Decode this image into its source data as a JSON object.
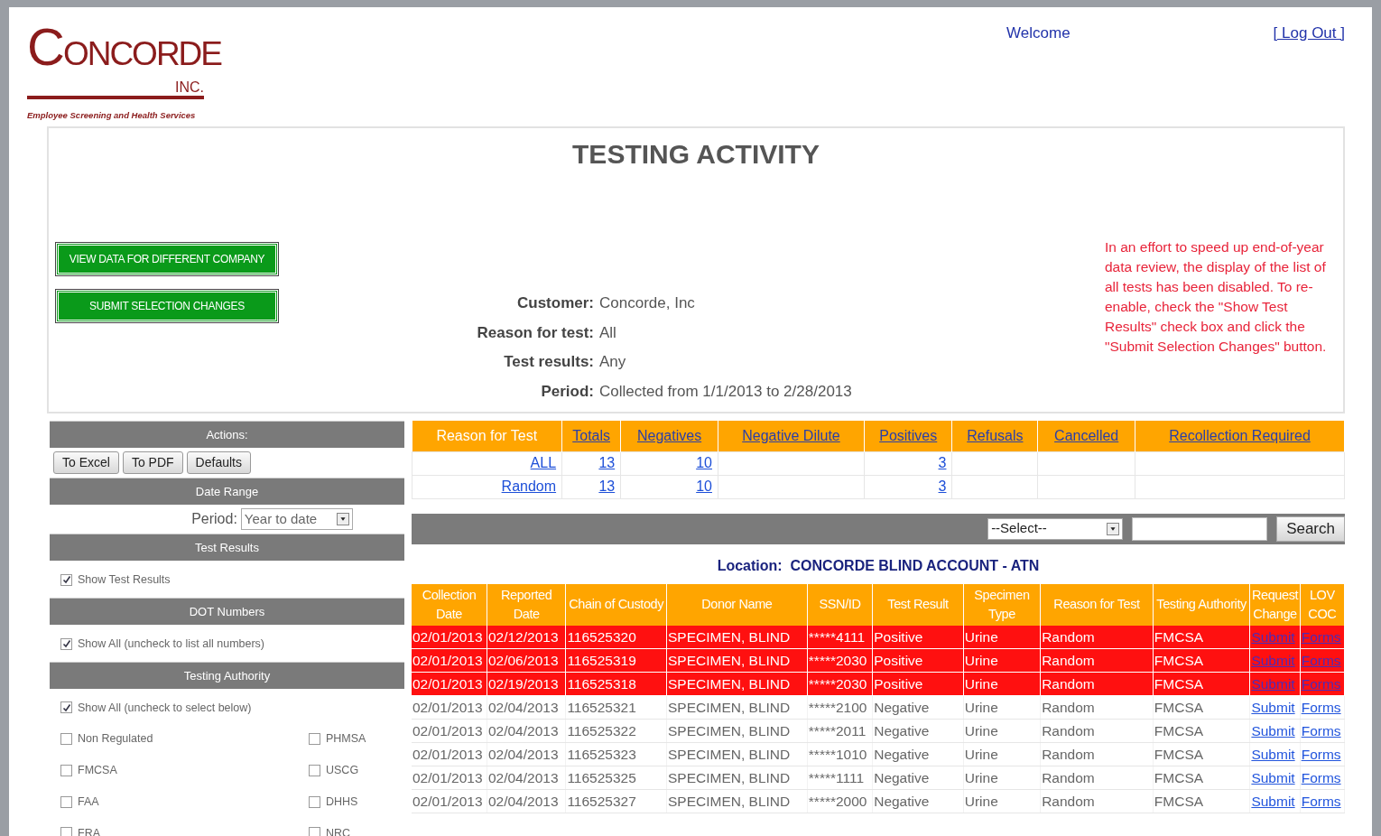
{
  "logo": {
    "name": "CONCORDE",
    "suffix": "INC.",
    "tagline": "Employee Screening and Health Services"
  },
  "header": {
    "welcome": "Welcome",
    "logout": "[ Log Out ]"
  },
  "title": "TESTING ACTIVITY",
  "action_buttons": [
    "VIEW DATA FOR DIFFERENT COMPANY",
    "SUBMIT SELECTION CHANGES"
  ],
  "summary": [
    {
      "label": "Customer:",
      "value": "Concorde, Inc"
    },
    {
      "label": "Reason for test:",
      "value": "All"
    },
    {
      "label": "Test results:",
      "value": "Any"
    },
    {
      "label": "Period:",
      "value": "Collected from 1/1/2013 to 2/28/2013"
    }
  ],
  "notice": "In an effort to speed up end-of-year data review, the display of the list of all tests has been disabled. To re-enable, check the \"Show Test Results\" check box and click the \"Submit Selection Changes\" button.",
  "sidebar": {
    "sections": [
      {
        "title": "Actions:",
        "kind": "buttons",
        "buttons": [
          "To Excel",
          "To PDF",
          "Defaults"
        ]
      },
      {
        "title": "Date Range",
        "kind": "select",
        "label": "Period:",
        "value": "Year to date"
      },
      {
        "title": "Test Results",
        "kind": "checks",
        "items": [
          {
            "label": "Show Test Results",
            "checked": true
          }
        ]
      },
      {
        "title": "DOT Numbers",
        "kind": "checks",
        "items": [
          {
            "label": "Show All (uncheck to list all numbers)",
            "checked": true
          }
        ]
      },
      {
        "title": "Testing Authority",
        "kind": "checks",
        "items": [
          {
            "label": "Show All (uncheck to select below)",
            "checked": true
          }
        ],
        "grid": [
          {
            "label": "Non Regulated",
            "checked": false
          },
          {
            "label": "PHMSA",
            "checked": false
          },
          {
            "label": "FMCSA",
            "checked": false
          },
          {
            "label": "USCG",
            "checked": false
          },
          {
            "label": "FAA",
            "checked": false
          },
          {
            "label": "DHHS",
            "checked": false
          },
          {
            "label": "FRA",
            "checked": false
          },
          {
            "label": "NRC",
            "checked": false
          }
        ]
      }
    ]
  },
  "totals": {
    "columns": [
      "Reason for Test",
      "Totals",
      "Negatives",
      "Negative Dilute",
      "Positives",
      "Refusals",
      "Cancelled",
      "Recollection Required"
    ],
    "rows": [
      [
        "ALL",
        "13",
        "10",
        "",
        "3",
        "",
        "",
        ""
      ],
      [
        "Random",
        "13",
        "10",
        "",
        "3",
        "",
        "",
        ""
      ]
    ]
  },
  "search": {
    "select": "--Select--",
    "button": "Search"
  },
  "location": "Location:  CONCORDE BLIND ACCOUNT - ATN",
  "results": {
    "columns": [
      "Collection Date",
      "Reported Date",
      "Chain of Custody",
      "Donor Name",
      "SSN/ID",
      "Test Result",
      "Specimen Type",
      "Reason for Test",
      "Testing Authority",
      "Request Change",
      "LOV COC"
    ],
    "rows": [
      {
        "flagged": true,
        "cells": [
          "02/01/2013",
          "02/12/2013",
          "116525320",
          "SPECIMEN, BLIND",
          "*****4111",
          "Positive",
          "Urine",
          "Random",
          "FMCSA",
          "Submit",
          "Forms"
        ]
      },
      {
        "flagged": true,
        "cells": [
          "02/01/2013",
          "02/06/2013",
          "116525319",
          "SPECIMEN, BLIND",
          "*****2030",
          "Positive",
          "Urine",
          "Random",
          "FMCSA",
          "Submit",
          "Forms"
        ]
      },
      {
        "flagged": true,
        "cells": [
          "02/01/2013",
          "02/19/2013",
          "116525318",
          "SPECIMEN, BLIND",
          "*****2030",
          "Positive",
          "Urine",
          "Random",
          "FMCSA",
          "Submit",
          "Forms"
        ]
      },
      {
        "flagged": false,
        "cells": [
          "02/01/2013",
          "02/04/2013",
          "116525321",
          "SPECIMEN, BLIND",
          "*****2100",
          "Negative",
          "Urine",
          "Random",
          "FMCSA",
          "Submit",
          "Forms"
        ]
      },
      {
        "flagged": false,
        "cells": [
          "02/01/2013",
          "02/04/2013",
          "116525322",
          "SPECIMEN, BLIND",
          "*****2011",
          "Negative",
          "Urine",
          "Random",
          "FMCSA",
          "Submit",
          "Forms"
        ]
      },
      {
        "flagged": false,
        "cells": [
          "02/01/2013",
          "02/04/2013",
          "116525323",
          "SPECIMEN, BLIND",
          "*****1010",
          "Negative",
          "Urine",
          "Random",
          "FMCSA",
          "Submit",
          "Forms"
        ]
      },
      {
        "flagged": false,
        "cells": [
          "02/01/2013",
          "02/04/2013",
          "116525325",
          "SPECIMEN, BLIND",
          "*****1111",
          "Negative",
          "Urine",
          "Random",
          "FMCSA",
          "Submit",
          "Forms"
        ]
      },
      {
        "flagged": false,
        "cells": [
          "02/01/2013",
          "02/04/2013",
          "116525327",
          "SPECIMEN, BLIND",
          "*****2000",
          "Negative",
          "Urine",
          "Random",
          "FMCSA",
          "Submit",
          "Forms"
        ]
      }
    ]
  }
}
